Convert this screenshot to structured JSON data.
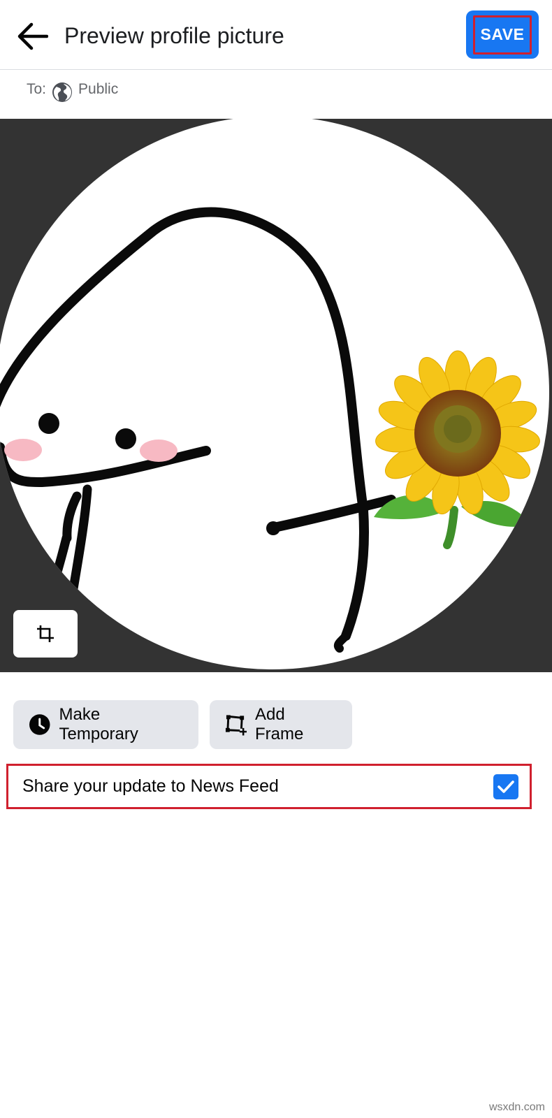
{
  "header": {
    "back_icon": "arrow-left-icon",
    "title": "Preview profile picture",
    "save_label": "SAVE"
  },
  "audience": {
    "prefix": "To:",
    "icon": "globe-icon",
    "value": "Public"
  },
  "photo": {
    "description_icon": "profile-photo",
    "crop_icon": "crop-icon"
  },
  "actions": {
    "make_temporary_label": "Make Temporary",
    "make_temporary_icon": "clock-icon",
    "add_frame_label": "Add Frame",
    "add_frame_icon": "frame-add-icon"
  },
  "share": {
    "label": "Share your update to News Feed",
    "checked": true
  },
  "watermark": "wsxdn.com",
  "colors": {
    "accent": "#1877f2",
    "highlight": "#d0202e",
    "photo_bg": "#333333",
    "button_bg": "#e4e6eb"
  }
}
